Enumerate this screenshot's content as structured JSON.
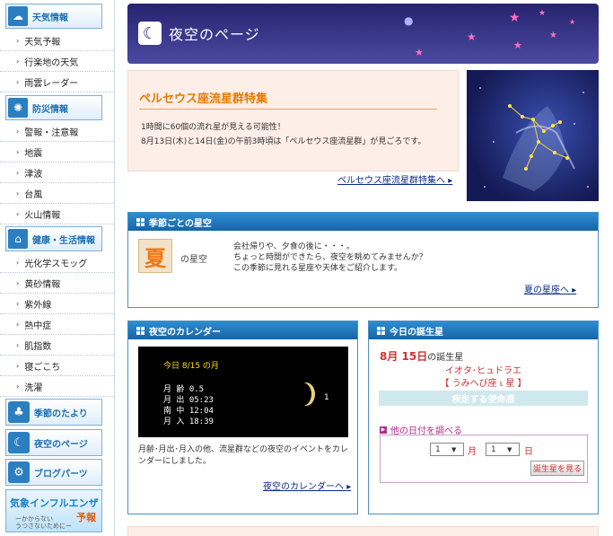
{
  "sidebar": {
    "weather": {
      "title": "天気情報",
      "items": [
        "天気予報",
        "行楽地の天気",
        "雨雲レーダー"
      ]
    },
    "disaster": {
      "title": "防災情報",
      "items": [
        "警報・注意報",
        "地震",
        "津波",
        "台風",
        "火山情報"
      ]
    },
    "health": {
      "title": "健康・生活情報",
      "items": [
        "光化学スモッグ",
        "黄砂情報",
        "紫外線",
        "熱中症",
        "肌指数",
        "寝ごこち",
        "洗濯"
      ]
    },
    "big_links": [
      "季節のたより",
      "夜空のページ",
      "ブログパーツ"
    ],
    "banner": {
      "line1": "気象インフルエンザ",
      "line2": "予報",
      "line3": "ーかからない\nうつさないためにー"
    }
  },
  "header": {
    "title": "夜空のページ"
  },
  "feature": {
    "title": "ペルセウス座流星群特集",
    "line1": "1時間に60個の流れ星が見える可能性！",
    "line2": "8月13日(木)と14日(金)の午前3時頃は「ペルセウス座流星群」が見ごろです。",
    "link": "ペルセウス座流星群特集へ"
  },
  "season": {
    "title": "季節ごとの星空",
    "badge": "夏",
    "badge_label": "の星空",
    "text": [
      "会社帰りや、夕食の後に・・・。",
      "ちょっと時間ができたら、夜空を眺めてみませんか？",
      "この季節に見れる星座や天体をご紹介します。"
    ],
    "link": "夏の星座へ"
  },
  "calendar": {
    "title": "夜空のカレンダー",
    "today": "今日 8/15 の月",
    "rows": [
      "月 齢 0.5",
      "月 出 05:23",
      "南 中 12:04",
      "月 入 18:39"
    ],
    "phase_number": "1",
    "description": "月齢･月出･月入の他、流星群などの夜空のイベントをカレンダーにしました。",
    "link": "夜空のカレンダーへ"
  },
  "birthstar": {
    "title": "今日の誕生星",
    "date_num": "8月 15日",
    "date_suffix": "の誕生星",
    "star_name": "イオタ･ヒュドラエ",
    "star_jp": "【 うみへび座 ι 星 】",
    "fate": "疾走する使命感",
    "other_label": "他の日付を調べる",
    "month_value": "1",
    "month_unit": "月",
    "day_value": "1",
    "day_unit": "日",
    "show_button": "誕生星を見る"
  },
  "colors": {
    "header_bg": "#26236f",
    "panel_head": "#1565a8",
    "accent_orange": "#e57a00",
    "accent_red": "#d03030"
  }
}
